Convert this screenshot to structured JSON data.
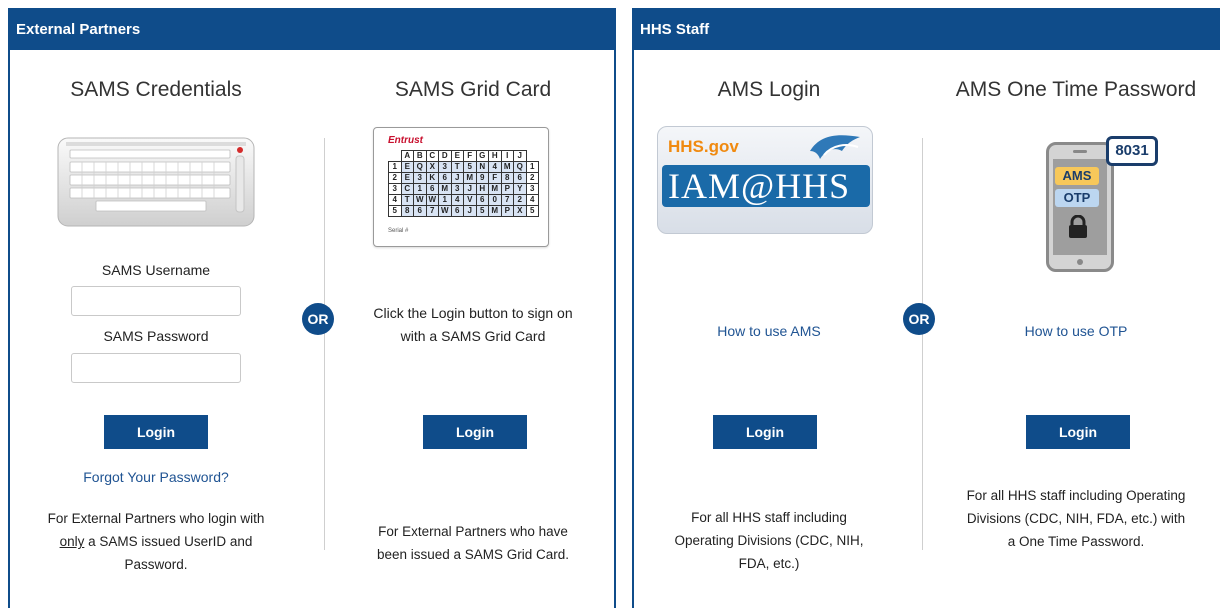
{
  "external_partners": {
    "header": "External Partners",
    "or_label": "OR",
    "sams_credentials": {
      "title": "SAMS Credentials",
      "username_label": "SAMS Username",
      "username_value": "",
      "password_label": "SAMS Password",
      "password_value": "",
      "login_label": "Login",
      "forgot_link": "Forgot Your Password?",
      "desc_line1": "For External Partners who login with",
      "desc_only": "only",
      "desc_line2_rest": " a SAMS issued UserID and",
      "desc_line3": "Password.",
      "icon": "keyboard-icon"
    },
    "sams_grid_card": {
      "title": "SAMS Grid Card",
      "instruction_line1": "Click the Login button to sign on",
      "instruction_line2": "with a SAMS Grid Card",
      "login_label": "Login",
      "desc_line1": "For External Partners who have",
      "desc_line2": "been issued a SAMS Grid Card.",
      "card": {
        "brand": "Entrust",
        "columns": [
          "A",
          "B",
          "C",
          "D",
          "E",
          "F",
          "G",
          "H",
          "I",
          "J"
        ],
        "rows": [
          {
            "num": "1",
            "cells": [
              "E",
              "Q",
              "X",
              "3",
              "T",
              "5",
              "N",
              "4",
              "M",
              "Q"
            ]
          },
          {
            "num": "2",
            "cells": [
              "E",
              "3",
              "K",
              "6",
              "J",
              "M",
              "9",
              "F",
              "8",
              "6"
            ]
          },
          {
            "num": "3",
            "cells": [
              "C",
              "1",
              "6",
              "M",
              "3",
              "J",
              "H",
              "M",
              "P",
              "Y"
            ]
          },
          {
            "num": "4",
            "cells": [
              "T",
              "W",
              "W",
              "1",
              "4",
              "V",
              "6",
              "0",
              "7",
              "2"
            ]
          },
          {
            "num": "5",
            "cells": [
              "8",
              "6",
              "7",
              "W",
              "6",
              "J",
              "5",
              "M",
              "P",
              "X"
            ]
          }
        ],
        "serial_label": "Serial #"
      }
    }
  },
  "hhs_staff": {
    "header": "HHS Staff",
    "or_label": "OR",
    "ams_login": {
      "title": "AMS Login",
      "badge_site": "HHS.gov",
      "badge_text": "IAM@HHS",
      "how_to_link": "How to use AMS",
      "login_label": "Login",
      "desc_line1": "For all HHS staff including",
      "desc_line2": "Operating Divisions (CDC, NIH,",
      "desc_line3": "FDA, etc.)"
    },
    "ams_otp": {
      "title": "AMS One Time Password",
      "bubble_code": "8031",
      "phone_ams": "AMS",
      "phone_otp": "OTP",
      "how_to_link": "How to use OTP",
      "login_label": "Login",
      "desc_line1": "For all HHS staff including Operating",
      "desc_line2": "Divisions (CDC, NIH, FDA, etc.) with",
      "desc_line3": "a One Time Password.",
      "icon": "smartphone-lock-icon"
    }
  },
  "colors": {
    "brand_blue": "#0f4c8a",
    "link_blue": "#205493",
    "otp_yellow": "#f7c85a",
    "hhs_orange": "#f08a10"
  }
}
